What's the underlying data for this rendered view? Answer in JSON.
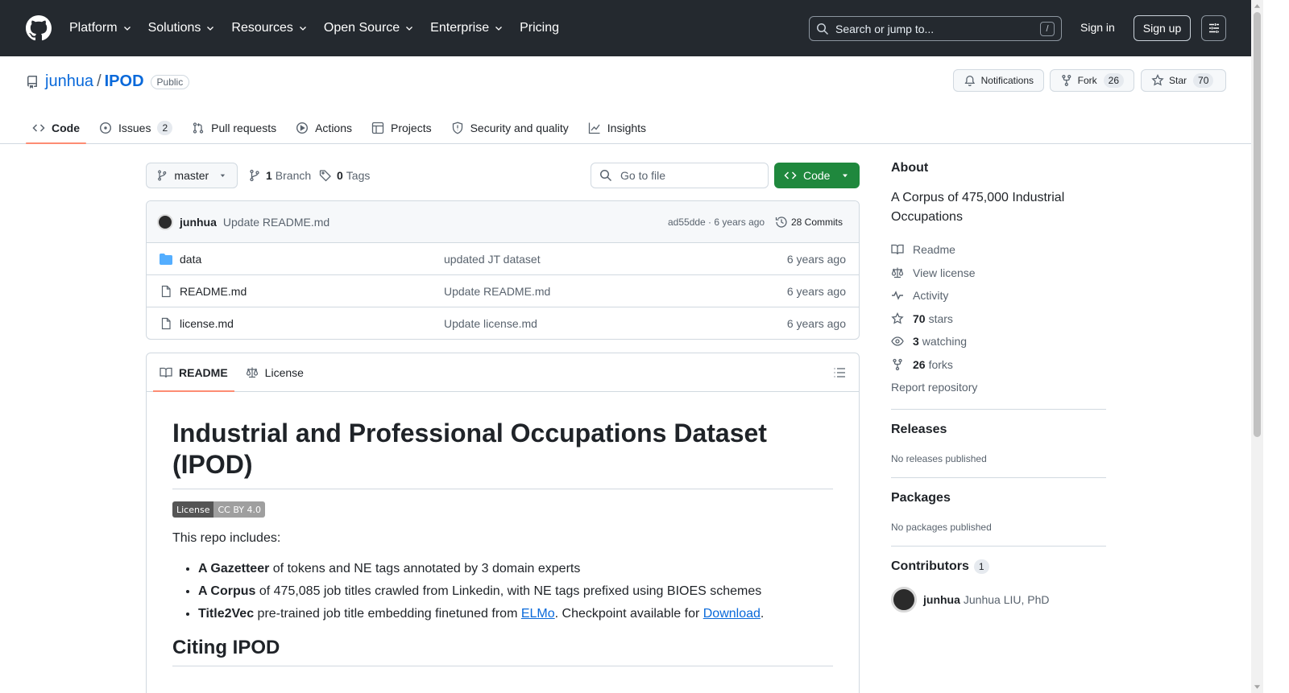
{
  "topnav": {
    "items": [
      "Platform",
      "Solutions",
      "Resources",
      "Open Source",
      "Enterprise",
      "Pricing"
    ],
    "search_placeholder": "Search or jump to...",
    "search_shortcut": "/",
    "signin": "Sign in",
    "signup": "Sign up"
  },
  "repo": {
    "owner": "junhua",
    "separator": "/",
    "name": "IPOD",
    "visibility": "Public",
    "notifications_label": "Notifications",
    "fork_label": "Fork",
    "fork_count": "26",
    "star_label": "Star",
    "star_count": "70"
  },
  "tabs": [
    {
      "label": "Code",
      "icon": "code-icon",
      "active": true
    },
    {
      "label": "Issues",
      "icon": "issue-icon",
      "count": "2"
    },
    {
      "label": "Pull requests",
      "icon": "pull-request-icon"
    },
    {
      "label": "Actions",
      "icon": "play-icon"
    },
    {
      "label": "Projects",
      "icon": "table-icon"
    },
    {
      "label": "Security and quality",
      "icon": "shield-icon"
    },
    {
      "label": "Insights",
      "icon": "graph-icon"
    }
  ],
  "toolbar": {
    "branch": "master",
    "branch_count": "1",
    "branch_label": "Branch",
    "tag_count": "0",
    "tag_label": "Tags",
    "goto_placeholder": "Go to file",
    "code_button": "Code"
  },
  "commit": {
    "author": "junhua",
    "message": "Update README.md",
    "sha_time": "ad55dde · 6 years ago",
    "count_label": "28 Commits"
  },
  "files": [
    {
      "type": "folder",
      "name": "data",
      "message": "updated JT dataset",
      "age": "6 years ago"
    },
    {
      "type": "file",
      "name": "README.md",
      "message": "Update README.md",
      "age": "6 years ago"
    },
    {
      "type": "file",
      "name": "license.md",
      "message": "Update license.md",
      "age": "6 years ago"
    }
  ],
  "readme": {
    "tab_readme": "README",
    "tab_license": "License",
    "title": "Industrial and Professional Occupations Dataset (IPOD)",
    "badge_left": "License",
    "badge_right": "CC BY 4.0",
    "intro": "This repo includes:",
    "bullets": [
      {
        "bold": "A Gazetteer",
        "text": " of tokens and NE tags annotated by 3 domain experts"
      },
      {
        "bold": "A Corpus",
        "text": " of 475,085 job titles crawled from Linkedin, with NE tags prefixed using BIOES schemes"
      },
      {
        "bold": "Title2Vec",
        "text": " pre-trained job title embedding finetuned from ",
        "link1": "ELMo",
        "mid": ". Checkpoint available for ",
        "link2": "Download",
        "end": "."
      }
    ],
    "h2": "Citing IPOD"
  },
  "sidebar": {
    "about_heading": "About",
    "description": "A Corpus of 475,000 Industrial Occupations",
    "links": {
      "readme": "Readme",
      "license": "View license",
      "activity": "Activity",
      "stars_count": "70",
      "stars_label": "stars",
      "watching_count": "3",
      "watching_label": "watching",
      "forks_count": "26",
      "forks_label": "forks",
      "report": "Report repository"
    },
    "releases_heading": "Releases",
    "releases_text": "No releases published",
    "packages_heading": "Packages",
    "packages_text": "No packages published",
    "contributors_heading": "Contributors",
    "contributors_count": "1",
    "contributor_username": "junhua",
    "contributor_name": "Junhua LIU, PhD"
  },
  "colors": {
    "header_bg": "#24292f",
    "accent_blue": "#0969da",
    "code_button_green": "#1f883d",
    "active_tab_underline": "#fd8c73"
  }
}
